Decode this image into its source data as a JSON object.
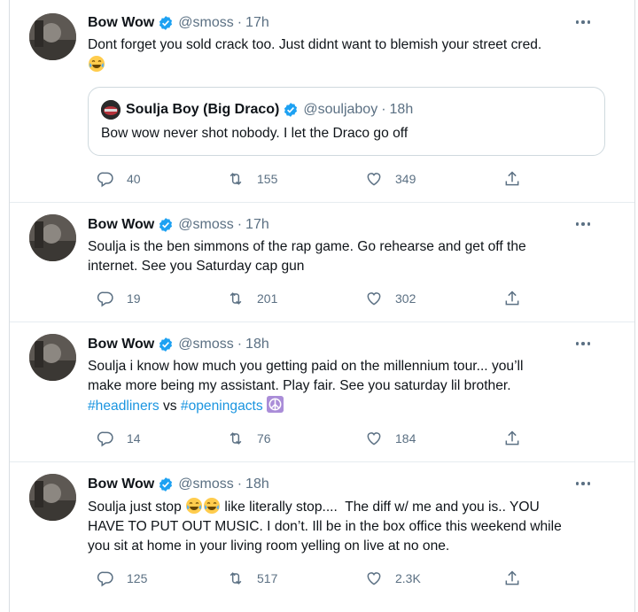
{
  "tweets": [
    {
      "name": "Bow Wow",
      "handle": "@smoss",
      "dot": "·",
      "time": "17h",
      "text_lines": [
        "Dont forget you sold crack too. Just didnt want to blemish your street cred."
      ],
      "emoji_line": "tears-of-joy-emoji",
      "quote": {
        "name": "Soulja Boy (Big Draco)",
        "handle": "@souljaboy",
        "dot": "·",
        "time": "18h",
        "text": "Bow wow never shot nobody. I let the Draco go off"
      },
      "replies": "40",
      "retweets": "155",
      "likes": "349"
    },
    {
      "name": "Bow Wow",
      "handle": "@smoss",
      "dot": "·",
      "time": "17h",
      "text_lines": [
        "Soulja is the ben simmons of the rap game. Go rehearse and get off the",
        "internet. See you Saturday cap gun"
      ],
      "replies": "19",
      "retweets": "201",
      "likes": "302"
    },
    {
      "name": "Bow Wow",
      "handle": "@smoss",
      "dot": "·",
      "time": "18h",
      "text_lines": [
        "Soulja i know how much you getting paid on the millennium tour... you’ll",
        "make more being my assistant. Play fair. See you saturday lil brother."
      ],
      "hashtag1": "#headliners",
      "vs": " vs ",
      "hashtag2": "#openingacts",
      "replies": "14",
      "retweets": "76",
      "likes": "184"
    },
    {
      "name": "Bow Wow",
      "handle": "@smoss",
      "dot": "·",
      "time": "18h",
      "line1_a": "Soulja just stop ",
      "line1_b": " like literally stop....  The diff w/ me and you is.. YOU",
      "text_lines": [
        "HAVE TO PUT OUT MUSIC. I don’t. Ill be in the box office this weekend while",
        "you sit at home in your living room yelling on live at no one."
      ],
      "replies": "125",
      "retweets": "517",
      "likes": "2.3K"
    }
  ],
  "colors": {
    "accent": "#1da1f2",
    "link": "#1b95e0",
    "muted": "#5b7083"
  },
  "icons": [
    "reply-icon",
    "retweet-icon",
    "like-icon",
    "share-icon",
    "verified-badge-icon",
    "more-icon"
  ]
}
